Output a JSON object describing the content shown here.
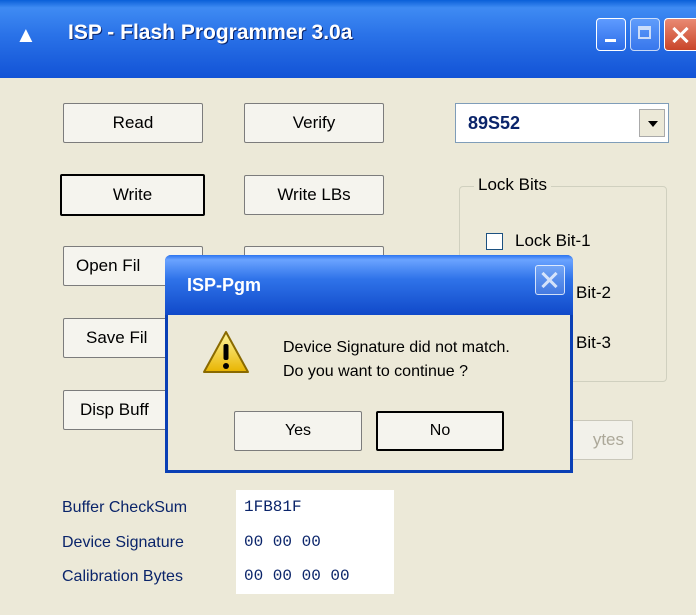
{
  "window": {
    "title": "ISP - Flash Programmer  3.0a",
    "icon": "app-triangle-icon"
  },
  "buttons": {
    "read": "Read",
    "verify": "Verify",
    "write": "Write",
    "write_lbs": "Write LBs",
    "open_file": "Open Fil",
    "save_file": "Save Fil",
    "disp_buffer": "Disp Buff",
    "bytes": "ytes"
  },
  "device_select": {
    "selected": "89S52"
  },
  "lock_bits": {
    "legend": "Lock Bits",
    "items": [
      {
        "label": "Lock Bit-1"
      },
      {
        "label": "Bit-2"
      },
      {
        "label": "Bit-3"
      }
    ]
  },
  "info": {
    "buffer_checksum_label": "Buffer CheckSum",
    "buffer_checksum_value": "1FB81F",
    "device_signature_label": "Device Signature",
    "device_signature_value": "00 00 00",
    "calibration_bytes_label": "Calibration Bytes",
    "calibration_bytes_value": "00 00 00 00"
  },
  "dialog": {
    "title": "ISP-Pgm",
    "message_line1": "Device Signature did not match.",
    "message_line2": "Do you want to continue ?",
    "yes_label": "Yes",
    "no_label": "No",
    "icon": "warning-icon"
  },
  "colors": {
    "titlebar": "#2a72e8",
    "face": "#ece9d8",
    "info_text": "#0a246a"
  }
}
